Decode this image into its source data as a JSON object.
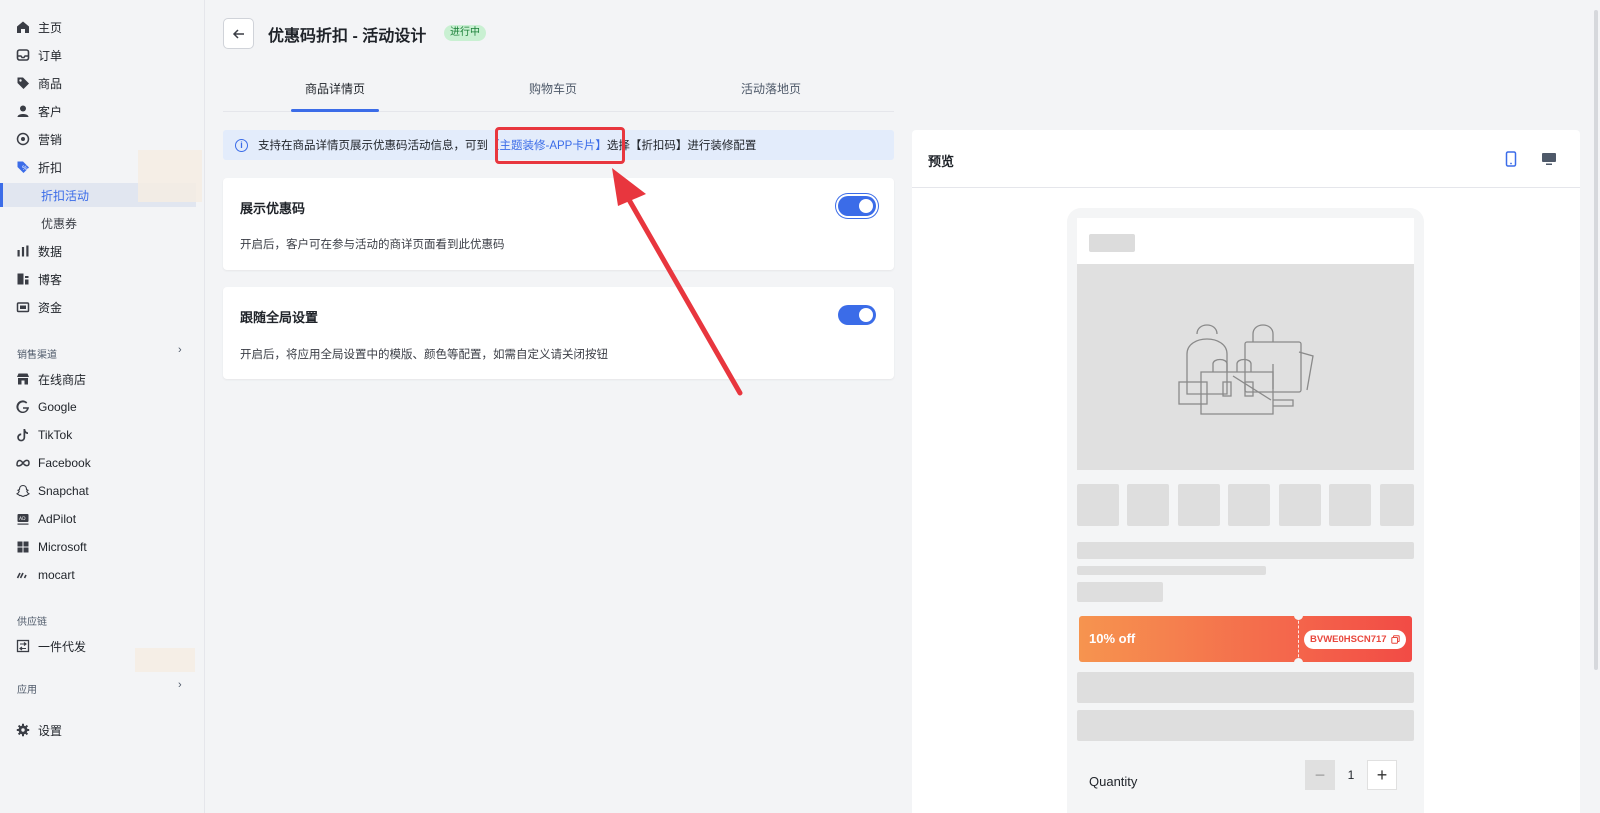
{
  "sidebar": {
    "items": [
      {
        "label": "主页",
        "icon": "home-icon"
      },
      {
        "label": "订单",
        "icon": "inbox-icon"
      },
      {
        "label": "商品",
        "icon": "tag-icon"
      },
      {
        "label": "客户",
        "icon": "user-icon"
      },
      {
        "label": "营销",
        "icon": "target-icon"
      },
      {
        "label": "折扣",
        "icon": "discount-icon"
      },
      {
        "label": "折扣活动",
        "sub": true,
        "active": true
      },
      {
        "label": "优惠券",
        "sub": true
      },
      {
        "label": "数据",
        "icon": "bar-chart-icon"
      },
      {
        "label": "博客",
        "icon": "blog-icon"
      },
      {
        "label": "资金",
        "icon": "wallet-icon"
      }
    ],
    "sales_channels_label": "销售渠道",
    "channels": [
      {
        "label": "在线商店",
        "icon": "store-icon"
      },
      {
        "label": "Google",
        "icon": "google-icon"
      },
      {
        "label": "TikTok",
        "icon": "tiktok-icon"
      },
      {
        "label": "Facebook",
        "icon": "meta-icon"
      },
      {
        "label": "Snapchat",
        "icon": "snapchat-icon"
      },
      {
        "label": "AdPilot",
        "icon": "adpilot-icon"
      },
      {
        "label": "Microsoft",
        "icon": "microsoft-icon"
      },
      {
        "label": "mocart",
        "icon": "mocart-icon"
      }
    ],
    "supply_chain_label": "供应链",
    "supply": [
      {
        "label": "一件代发",
        "icon": "dropship-icon"
      }
    ],
    "apps_label": "应用",
    "settings_label": "设置"
  },
  "header": {
    "title": "优惠码折扣 - 活动设计",
    "status": "进行中"
  },
  "tabs": [
    {
      "label": "商品详情页",
      "active": true
    },
    {
      "label": "购物车页"
    },
    {
      "label": "活动落地页"
    }
  ],
  "banner": {
    "text_before": "支持在商品详情页展示优惠码活动信息，可到",
    "link": "【主题装修-APP卡片】",
    "text_after": "选择【折扣码】进行装修配置"
  },
  "cards": [
    {
      "title": "展示优惠码",
      "desc": "开启后，客户可在参与活动的商详页面看到此优惠码",
      "enabled": true
    },
    {
      "title": "跟随全局设置",
      "desc": "开启后，将应用全局设置中的模版、颜色等配置，如需自定义请关闭按钮",
      "enabled": true
    }
  ],
  "preview": {
    "title": "预览",
    "coupon_off": "10% off",
    "coupon_code": "BVWE0HSCN717",
    "quantity_label": "Quantity",
    "quantity_value": "1",
    "minus": "−",
    "plus": "+"
  },
  "colors": {
    "accent": "#3b6ce8",
    "annotation": "#e8363e",
    "coupon_start": "#f6944f",
    "coupon_end": "#f24b45",
    "status_bg": "#c9f0d2"
  }
}
